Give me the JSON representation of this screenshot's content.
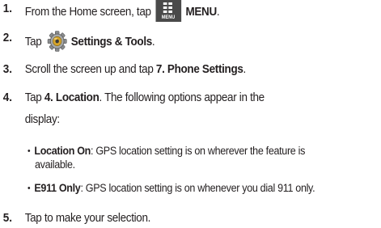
{
  "steps": [
    {
      "number": "1.",
      "text_before": "From the Home screen, tap",
      "icon": "menu-icon",
      "icon_caption": "MENU",
      "bold": "MENU",
      "text_after": "."
    },
    {
      "number": "2.",
      "text_before": "Tap",
      "icon": "settings-gear-icon",
      "bold": "Settings & Tools",
      "text_after": "."
    },
    {
      "number": "3.",
      "text_before": "Scroll the screen up and tap ",
      "bold": "7. Phone Settings",
      "text_after": "."
    },
    {
      "number": "4.",
      "text_before": "Tap ",
      "bold": "4. Location",
      "text_after": ". The following options appear in the",
      "continuation": "display:",
      "options": [
        {
          "bullet": "•",
          "label": "Location On",
          "description_line1": ": GPS location setting is on wherever the feature is",
          "description_line2": "available."
        },
        {
          "bullet": "•",
          "label": "E911 Only",
          "description_line1": ": GPS location setting is on whenever you dial 911 only."
        }
      ]
    },
    {
      "number": "5.",
      "text_before": "Tap to make your selection."
    }
  ]
}
